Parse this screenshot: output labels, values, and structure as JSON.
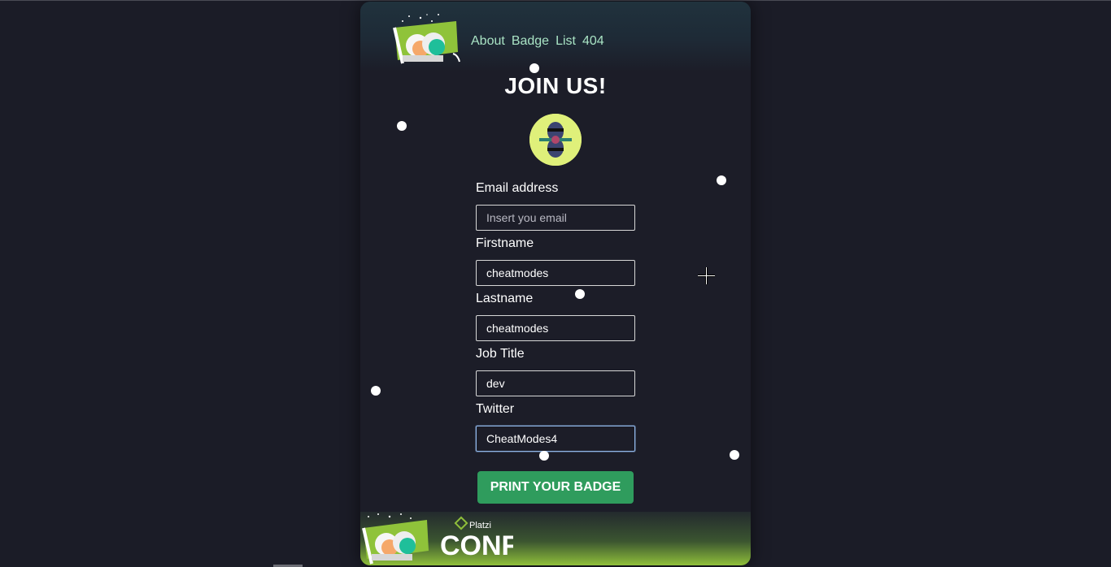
{
  "nav": {
    "links": [
      "About",
      "Badge",
      "List",
      "404"
    ]
  },
  "title": "JOIN US!",
  "form": {
    "email": {
      "label": "Email address",
      "value": "",
      "placeholder": "Insert you email"
    },
    "firstname": {
      "label": "Firstname",
      "value": "cheatmodes"
    },
    "lastname": {
      "label": "Lastname",
      "value": "cheatmodes"
    },
    "job_title": {
      "label": "Job Title",
      "value": "dev"
    },
    "twitter": {
      "label": "Twitter",
      "value": "CheatModes4"
    },
    "submit_label": "PRINT YOUR BADGE"
  },
  "footer": {
    "brand": "Platzi",
    "wordmark": "CONF"
  },
  "icons": {
    "logo": "conf-logo-icon",
    "avatar": "user-avatar",
    "cursor": "crosshair-cursor-icon"
  },
  "colors": {
    "background": "#1b1c27",
    "nav_link": "#a9e3c4",
    "button": "#2f9c5d",
    "footer_accent": "#8fbf3a"
  }
}
